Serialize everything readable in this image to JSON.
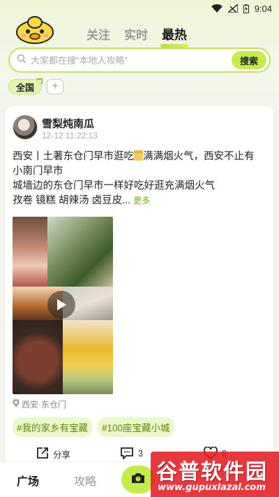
{
  "status": {
    "time": "9:04"
  },
  "header": {
    "tabs": [
      {
        "label": "关注",
        "active": false
      },
      {
        "label": "实时",
        "active": false
      },
      {
        "label": "最热",
        "active": true
      }
    ]
  },
  "search": {
    "placeholder": "大家都在搜“本地人攻略”",
    "button": "搜索"
  },
  "region": {
    "selected": "全国",
    "add": "+"
  },
  "post": {
    "username": "雪梨炖南瓜",
    "time": "12-12 11:22:13",
    "line1a": "西安丨土著东仓门早市逛吃",
    "line1b": "满满烟火气，西安不止有",
    "line2": "小南门早市",
    "line3": "城墙边的东仓门早市一样好吃好逛充满烟火气",
    "line4": "孜卷 镜糕 胡辣汤 卤豆皮...",
    "more": "更多",
    "location": "西安·东仓门",
    "tags": [
      "#我的家乡有宝藏",
      "#100座宝藏小城"
    ],
    "share_label": "分享",
    "comment_count": "3",
    "like_count": "8"
  },
  "bottom_nav": {
    "plaza": "广场",
    "guide": "攻略"
  },
  "watermark": {
    "title": "谷普软件园",
    "url": "www.gupuxlazal.com"
  },
  "colors": {
    "accent": "#c7ea4e",
    "tag_text": "#5b8a10",
    "watermark": "#e11e26"
  }
}
